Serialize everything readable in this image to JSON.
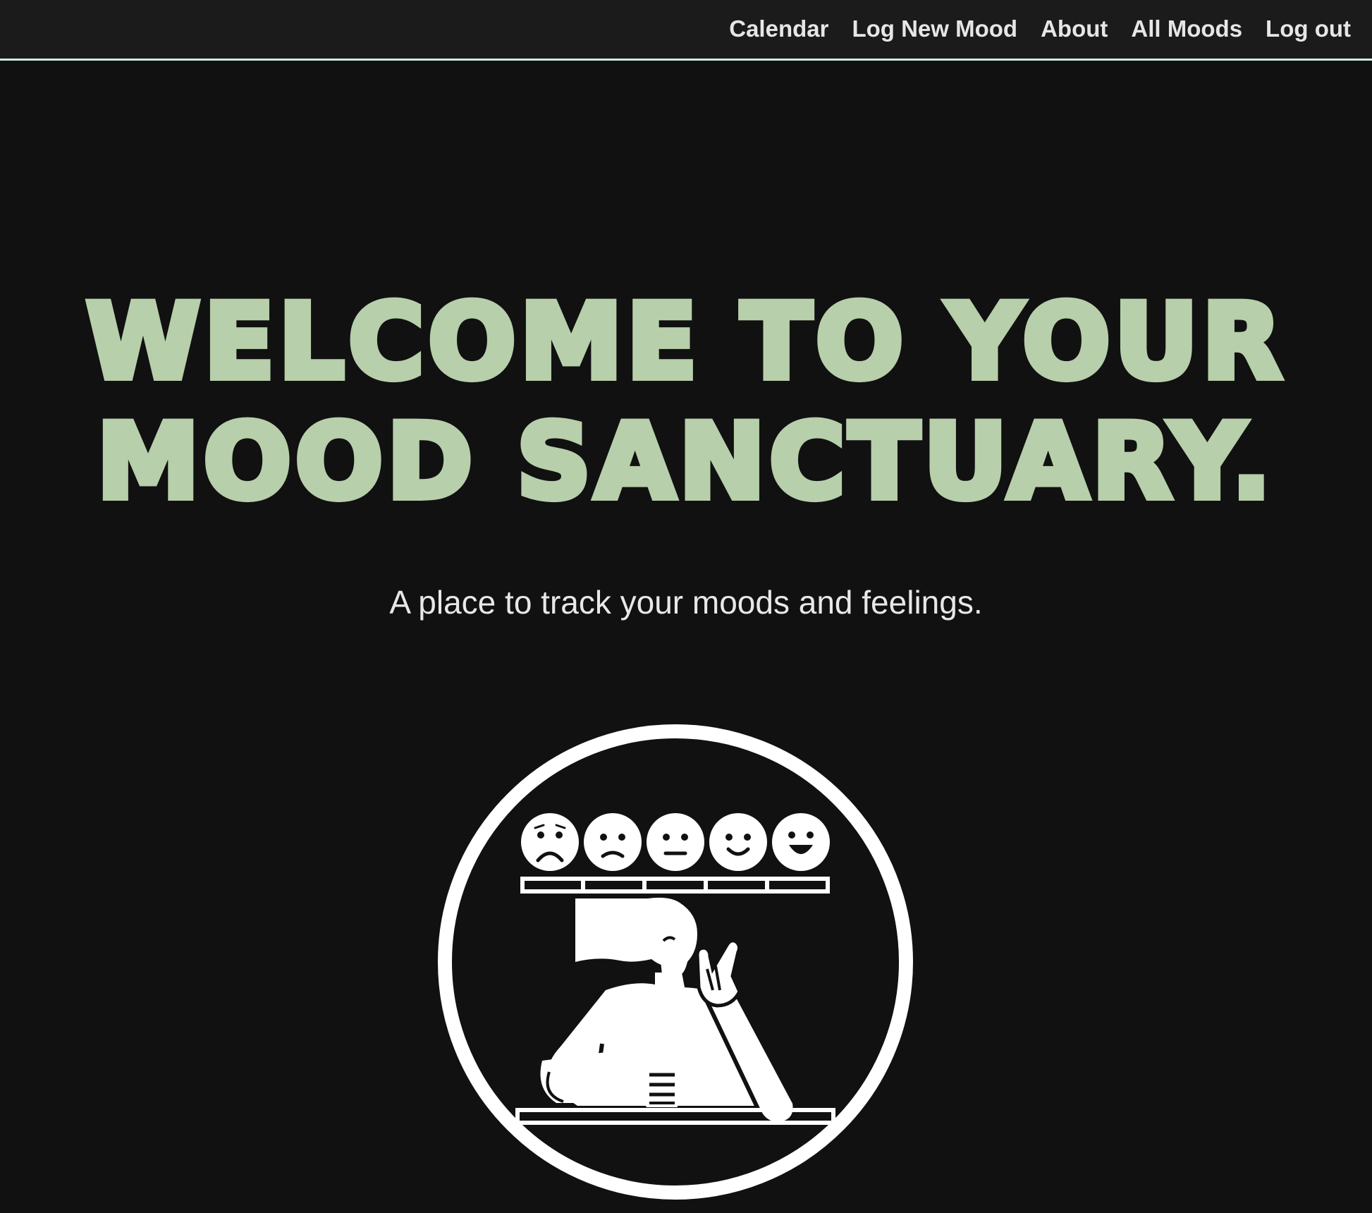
{
  "nav": {
    "items": [
      {
        "label": "Calendar"
      },
      {
        "label": "Log New Mood"
      },
      {
        "label": "About"
      },
      {
        "label": "All Moods"
      },
      {
        "label": "Log out"
      }
    ]
  },
  "hero": {
    "title_line1": "WELCOME TO YOUR",
    "title_line2": "MOOD SANCTUARY.",
    "subtitle": "A place to track your moods and feelings."
  },
  "illustration": {
    "icon": "mood-tracking-person-icon",
    "faces": [
      "very-sad-face-icon",
      "sad-face-icon",
      "neutral-face-icon",
      "happy-face-icon",
      "very-happy-face-icon"
    ]
  },
  "colors": {
    "background": "#111111",
    "navbar": "#1b1b1b",
    "nav_border": "#cfe9dc",
    "accent_green": "#b7cfab",
    "text_light": "#e8e8e8"
  }
}
